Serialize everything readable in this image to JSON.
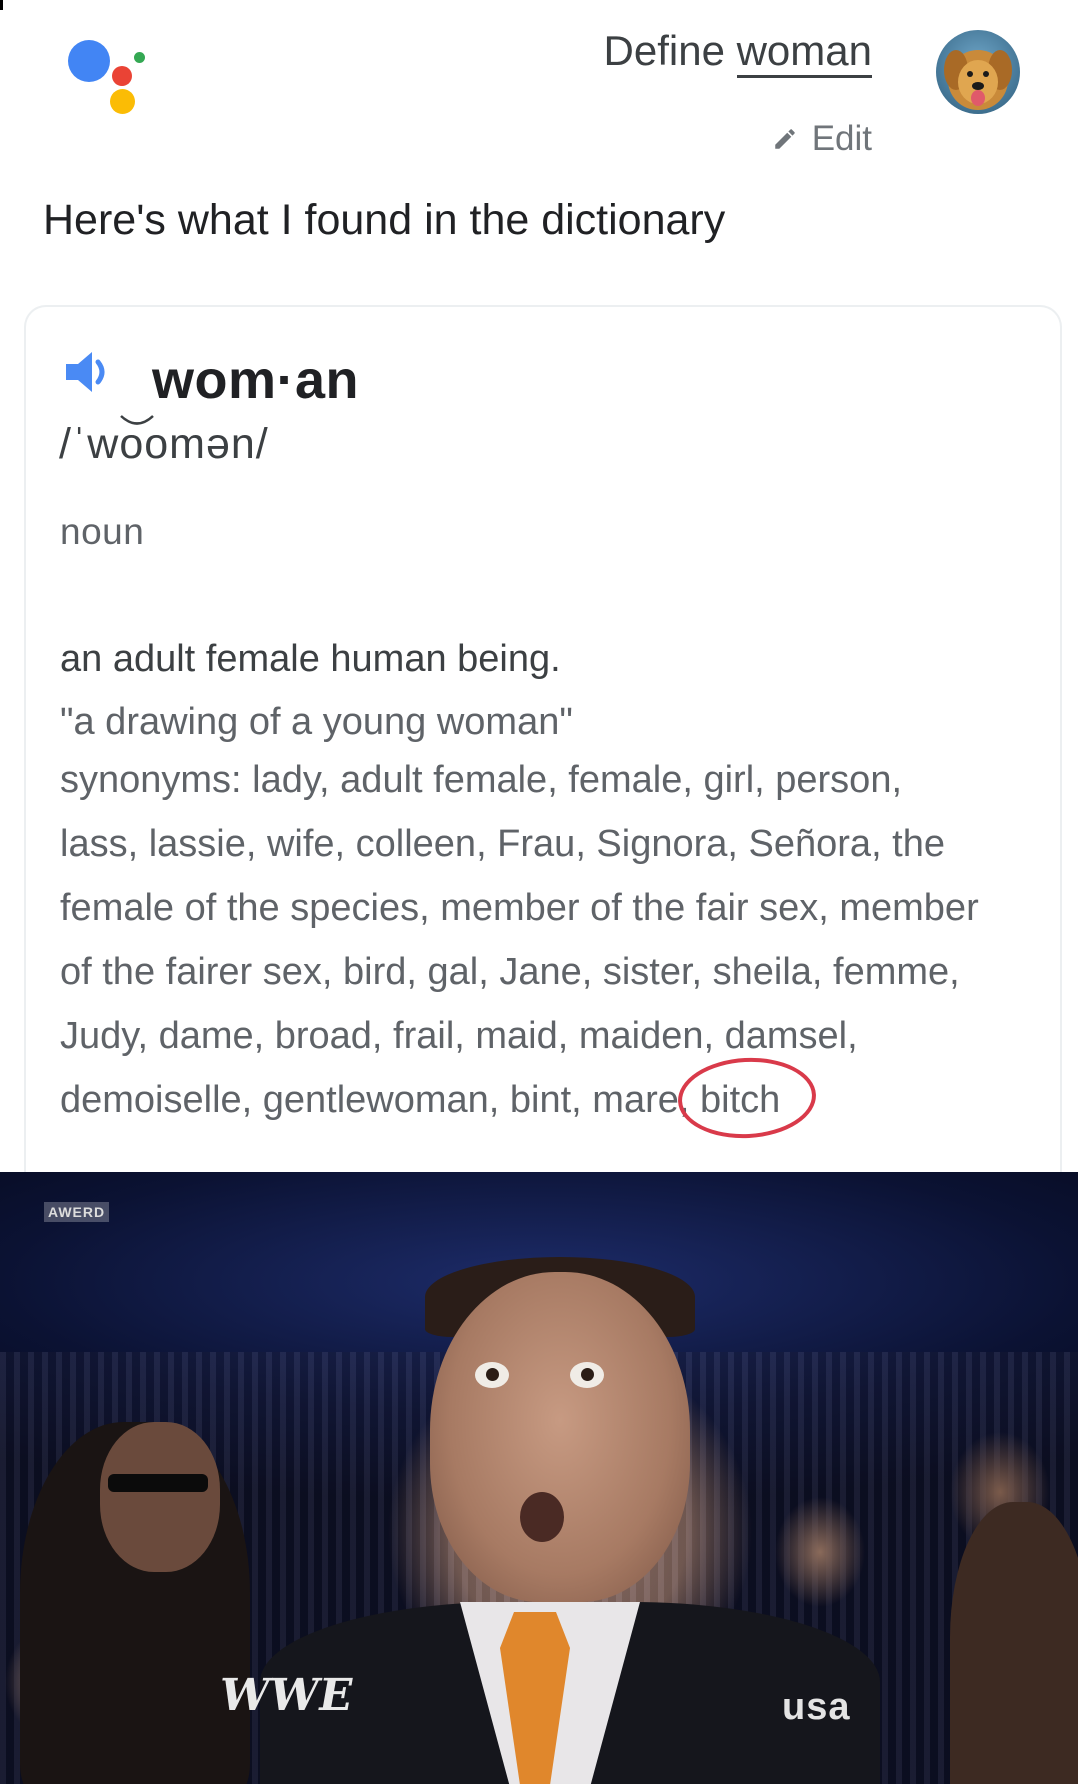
{
  "assistant": {
    "query_prefix": "Define",
    "query_word": "woman",
    "edit_label": "Edit",
    "response_intro": "Here's what I found in the dictionary"
  },
  "dictionary": {
    "headword": "wom·an",
    "pronunciation": "/ˈwoomən/",
    "part_of_speech": "noun",
    "definition": "an adult female human being.",
    "example": "\"a drawing of a young woman\"",
    "synonyms_lines": [
      "synonyms: lady, adult female, female, girl, person,",
      "lass, lassie, wife, colleen, Frau, Signora, Señora, the",
      "female of the species, member of the fair sex, member",
      "of the fairer sex, bird, gal, Jane, sister, sheila, femme,",
      "Judy, dame, broad, frail, maid, maiden, damsel,"
    ],
    "last_line_prefix": "demoiselle, gentlewoman, bint, mare, ",
    "circled_word": "bitch",
    "circle_color": "#d93a4a"
  },
  "reaction_image": {
    "network_logo": "WWE",
    "channel_logo": "usa",
    "corner_bug": "AWERD"
  },
  "colors": {
    "google_blue": "#4285f4",
    "google_red": "#ea4335",
    "google_yellow": "#fbbc05",
    "google_green": "#34a853",
    "speaker_blue": "#4a8af4"
  }
}
